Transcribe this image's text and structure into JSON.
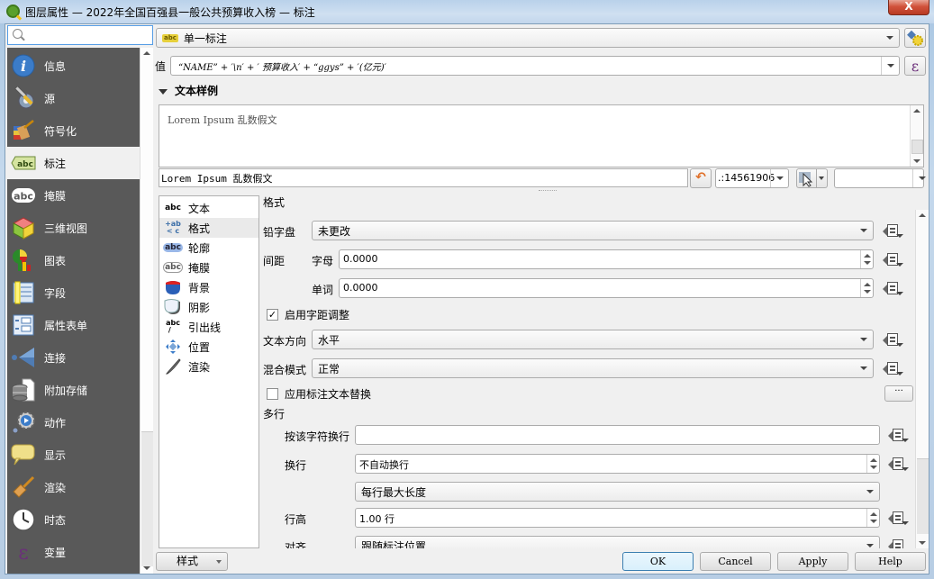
{
  "window": {
    "title": "图层属性 — 2022年全国百强县一般公共预算收入榜 — 标注",
    "close_label": "X"
  },
  "search": {
    "value": "",
    "placeholder": ""
  },
  "sidebar": {
    "items": [
      {
        "label": "信息",
        "icon": "info-icon"
      },
      {
        "label": "源",
        "icon": "source-icon"
      },
      {
        "label": "符号化",
        "icon": "symbology-icon"
      },
      {
        "label": "标注",
        "icon": "labels-icon",
        "active": true
      },
      {
        "label": "掩膜",
        "icon": "mask-icon"
      },
      {
        "label": "三维视图",
        "icon": "3d-view-icon"
      },
      {
        "label": "图表",
        "icon": "diagram-icon"
      },
      {
        "label": "字段",
        "icon": "fields-icon"
      },
      {
        "label": "属性表单",
        "icon": "attributes-form-icon"
      },
      {
        "label": "连接",
        "icon": "joins-icon"
      },
      {
        "label": "附加存储",
        "icon": "auxiliary-storage-icon"
      },
      {
        "label": "动作",
        "icon": "actions-icon"
      },
      {
        "label": "显示",
        "icon": "display-icon"
      },
      {
        "label": "渲染",
        "icon": "rendering-icon"
      },
      {
        "label": "时态",
        "icon": "temporal-icon"
      },
      {
        "label": "变量",
        "icon": "variables-icon"
      }
    ]
  },
  "labeling": {
    "mode": "单一标注",
    "value_label": "值",
    "expression": "\"NAME\" + '\\n' + ' 预算收入' + \"ggys\" + '(亿元)'",
    "expression_display": "“NAME” + ′\\n′ + ′ 预算收入′ + “ggys” + ′(亿元)′",
    "epsilon": "ε"
  },
  "text_sample": {
    "title": "文本样例",
    "preview": "Lorem Ipsum 乱数假文",
    "input": "Lorem Ipsum 乱数假文",
    "scale": ".:14561906"
  },
  "tabs": [
    {
      "label": "文本",
      "icon": "text-icon"
    },
    {
      "label": "格式",
      "icon": "formatting-icon",
      "active": true
    },
    {
      "label": "轮廓",
      "icon": "buffer-icon"
    },
    {
      "label": "掩膜",
      "icon": "mask-icon"
    },
    {
      "label": "背景",
      "icon": "background-icon"
    },
    {
      "label": "阴影",
      "icon": "shadow-icon"
    },
    {
      "label": "引出线",
      "icon": "callouts-icon"
    },
    {
      "label": "位置",
      "icon": "placement-icon"
    },
    {
      "label": "渲染",
      "icon": "rendering-icon"
    }
  ],
  "format": {
    "section_title": "格式",
    "typecase_label": "铅字盘",
    "typecase_value": "未更改",
    "spacing_label": "间距",
    "letter_label": "字母",
    "letter_value": "0.0000",
    "word_label": "单词",
    "word_value": "0.0000",
    "kerning_label": "启用字距调整",
    "kerning_checked": true,
    "direction_label": "文本方向",
    "direction_value": "水平",
    "blend_label": "混合模式",
    "blend_value": "正常",
    "substitutions_label": "应用标注文本替换",
    "substitutions_checked": false,
    "more_label": "···",
    "multiline_title": "多行",
    "wrap_char_label": "按该字符换行",
    "wrap_char_value": "",
    "wrap_label": "换行",
    "wrap_value": "不自动换行",
    "wrap_mode_value": "每行最大长度",
    "line_height_label": "行高",
    "line_height_value": "1.00 行",
    "align_label": "对齐",
    "align_value": "跟随标注位置"
  },
  "footer": {
    "style_label": "样式",
    "ok": "OK",
    "cancel": "Cancel",
    "apply": "Apply",
    "help": "Help"
  }
}
